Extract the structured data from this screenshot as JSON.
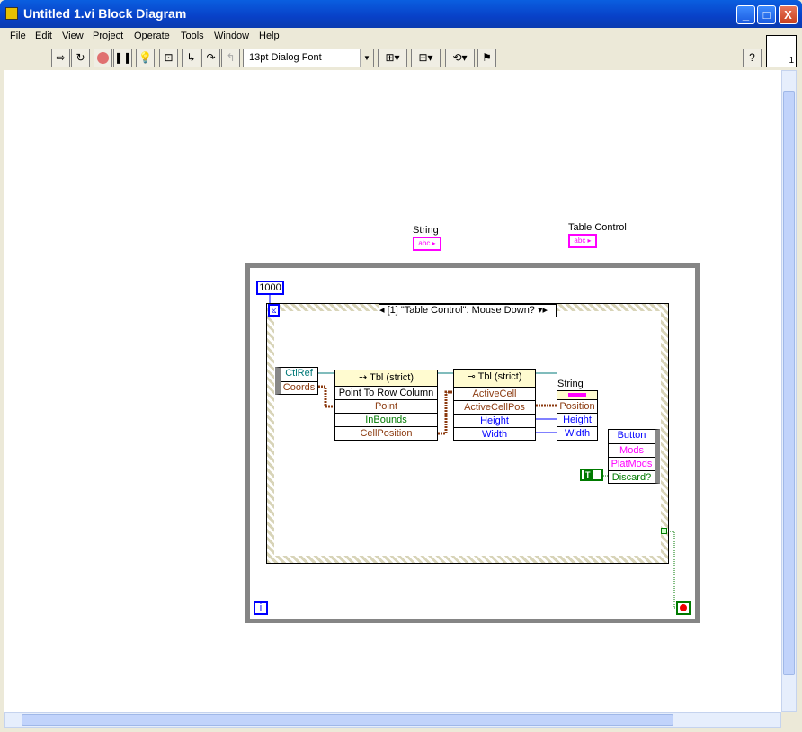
{
  "window": {
    "title": "Untitled 1.vi Block Diagram",
    "minimize": "_",
    "maximize": "□",
    "close": "X"
  },
  "menu": [
    "File",
    "Edit",
    "View",
    "Project",
    "Operate",
    "Tools",
    "Window",
    "Help"
  ],
  "toolbar": {
    "font": "13pt Dialog Font",
    "help": "?",
    "icons": [
      "run-arrow",
      "run-continuously",
      "abort",
      "pause",
      "highlight-execution",
      "retain-wire-values",
      "step-into",
      "step-over",
      "step-out",
      "align",
      "distribute",
      "reorder",
      "cleanup"
    ]
  },
  "connector_pane_number": "1",
  "diagram": {
    "string_label": "String",
    "string_terminal": "abc",
    "table_label": "Table Control",
    "table_terminal": "abc",
    "timeout_constant": "1000",
    "event_selector": "[1] \"Table Control\": Mouse Down?",
    "event_data": [
      "CtlRef",
      "Coords"
    ],
    "invoke_node": {
      "header": "Tbl (strict)",
      "method": "Point To Row Column",
      "rows": [
        "Point",
        "InBounds",
        "CellPosition"
      ]
    },
    "property_node": {
      "header": "Tbl (strict)",
      "rows": [
        "ActiveCell",
        "ActiveCellPos",
        "Height",
        "Width"
      ]
    },
    "string_node": {
      "label": "String",
      "rows": [
        "Position",
        "Height",
        "Width"
      ]
    },
    "filter_node": [
      "Button",
      "Mods",
      "PlatMods",
      "Discard?"
    ],
    "true_constant": "T",
    "iteration": "i"
  },
  "colors": {
    "cluster": "#8b3a0f",
    "numeric": "#0000ff",
    "boolean": "#007a00",
    "string": "#ff00ff",
    "refnum": "#007878"
  }
}
